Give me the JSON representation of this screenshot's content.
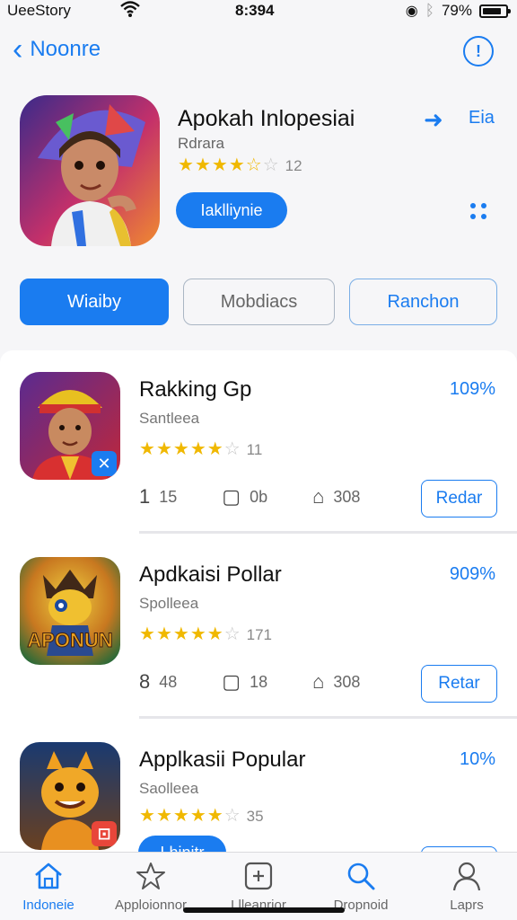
{
  "status_bar": {
    "carrier": "UeeStory",
    "time": "8:394",
    "battery": "79%"
  },
  "nav": {
    "back_label": "Noonre",
    "info_glyph": "!"
  },
  "hero": {
    "title": "Apokah Inlopesiai",
    "subtitle": "Rdrara",
    "rating": 4.5,
    "rating_count": "12",
    "button_label": "Iaklliynie",
    "share_label": "Eia"
  },
  "tabs": [
    {
      "label": "Wiaiby",
      "active": true
    },
    {
      "label": "Mobdiacs",
      "active": false
    },
    {
      "label": "Ranchon",
      "active": false
    }
  ],
  "apps": [
    {
      "title": "Rakking Gp",
      "subtitle": "Santleea",
      "rating": 4.5,
      "rating_count": "11",
      "percent": "109%",
      "badge": "✕",
      "metrics": [
        {
          "glyph": "1",
          "value": "15"
        },
        {
          "glyph": "▢",
          "value": "0b"
        },
        {
          "glyph": "⌂",
          "value": "308"
        }
      ],
      "action_label": "Redar"
    },
    {
      "title": "Apdkaisi Pollar",
      "subtitle": "Spolleea",
      "rating": 4.5,
      "rating_count": "171",
      "percent": "909%",
      "icon_text": "APONUN",
      "metrics": [
        {
          "glyph": "8",
          "value": "48"
        },
        {
          "glyph": "▢",
          "value": "18"
        },
        {
          "glyph": "⌂",
          "value": "308"
        }
      ],
      "action_label": "Retar"
    },
    {
      "title": "Applkasii Popular",
      "subtitle": "Saolleea",
      "rating": 4.5,
      "rating_count": "35",
      "percent": "10%",
      "badge": "⊡",
      "button_label": "Lhinitr"
    }
  ],
  "tabbar": [
    {
      "label": "Indoneie",
      "icon": "home-icon",
      "active": true
    },
    {
      "label": "Apploionnor",
      "icon": "star-icon",
      "active": false
    },
    {
      "label": "Llleanrior",
      "icon": "plus-square-icon",
      "active": false
    },
    {
      "label": "Dropnoid",
      "icon": "search-icon",
      "active": false
    },
    {
      "label": "Laprs",
      "icon": "person-icon",
      "active": false
    }
  ],
  "colors": {
    "accent": "#1a7cf0",
    "star": "#f0b800"
  }
}
